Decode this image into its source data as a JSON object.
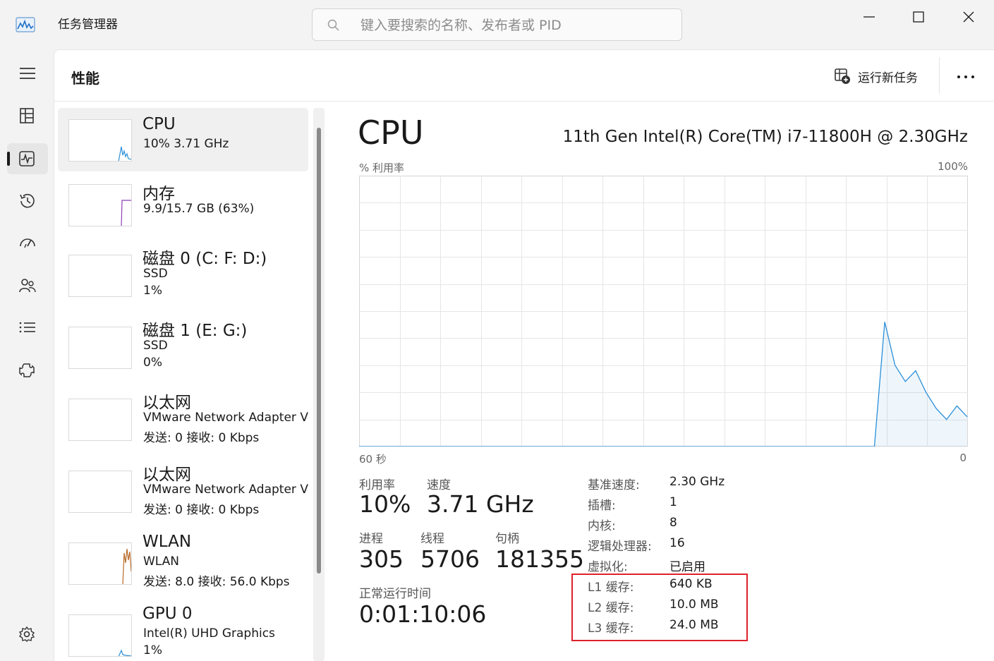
{
  "app": {
    "title": "任务管理器",
    "icon": "task-manager-icon"
  },
  "search": {
    "placeholder": "键入要搜索的名称、发布者或 PID",
    "value": ""
  },
  "window_controls": [
    "minimize-icon",
    "maximize-icon",
    "close-icon"
  ],
  "nav": {
    "items": [
      {
        "name": "hamburger-icon",
        "active": false
      },
      {
        "name": "processes-icon",
        "active": false
      },
      {
        "name": "performance-icon",
        "active": true
      },
      {
        "name": "app-history-icon",
        "active": false
      },
      {
        "name": "startup-apps-icon",
        "active": false
      },
      {
        "name": "users-icon",
        "active": false
      },
      {
        "name": "details-icon",
        "active": false
      },
      {
        "name": "services-icon",
        "active": false
      },
      {
        "name": "settings-icon",
        "active": false
      }
    ]
  },
  "header": {
    "title": "性能",
    "run_task_label": "运行新任务",
    "more_label": "更多"
  },
  "devices": [
    {
      "name": "CPU",
      "line1": "10%  3.71 GHz",
      "line2": "",
      "selected": true,
      "graph_color": "#2b8fd8"
    },
    {
      "name": "内存",
      "line1": "9.9/15.7 GB (63%)",
      "line2": "",
      "selected": false,
      "graph_color": "#8e3fb8"
    },
    {
      "name": "磁盘 0 (C: F: D:)",
      "line1": "SSD",
      "line2": "1%",
      "selected": false,
      "graph_color": "#4c9a2a"
    },
    {
      "name": "磁盘 1 (E: G:)",
      "line1": "SSD",
      "line2": "0%",
      "selected": false,
      "graph_color": "#4c9a2a"
    },
    {
      "name": "以太网",
      "line1": "VMware Network Adapter V",
      "line2": "发送: 0  接收: 0 Kbps",
      "selected": false,
      "graph_color": "#b86b2a"
    },
    {
      "name": "以太网",
      "line1": "VMware Network Adapter V",
      "line2": "发送: 0  接收: 0 Kbps",
      "selected": false,
      "graph_color": "#b86b2a"
    },
    {
      "name": "WLAN",
      "line1": "WLAN",
      "line2": "发送: 8.0  接收: 56.0 Kbps",
      "selected": false,
      "graph_color": "#b86b2a"
    },
    {
      "name": "GPU 0",
      "line1": "Intel(R) UHD Graphics",
      "line2": "1%",
      "selected": false,
      "graph_color": "#2b8fd8"
    }
  ],
  "cpu": {
    "title": "CPU",
    "model": "11th Gen Intel(R) Core(TM) i7-11800H @ 2.30GHz",
    "graph_top_left": "% 利用率",
    "graph_top_right": "100%",
    "graph_bottom_left": "60 秒",
    "graph_bottom_right": "0",
    "graph_color": "#2b8fd8",
    "utilization_history": [
      0,
      0,
      0,
      0,
      0,
      0,
      0,
      0,
      0,
      0,
      0,
      0,
      0,
      0,
      0,
      0,
      0,
      0,
      0,
      0,
      0,
      0,
      0,
      0,
      0,
      0,
      0,
      0,
      0,
      0,
      0,
      0,
      0,
      0,
      0,
      0,
      0,
      0,
      0,
      0,
      0,
      0,
      0,
      0,
      0,
      0,
      0,
      0,
      0,
      0,
      0,
      46,
      30,
      24,
      28,
      20,
      14,
      10,
      15,
      11
    ],
    "stats": {
      "utilization_label": "利用率",
      "utilization": "10%",
      "speed_label": "速度",
      "speed": "3.71 GHz",
      "processes_label": "进程",
      "processes": "305",
      "threads_label": "线程",
      "threads": "5706",
      "handles_label": "句柄",
      "handles": "181355",
      "uptime_label": "正常运行时间",
      "uptime": "0:01:10:06"
    },
    "specs": [
      {
        "label": "基准速度:",
        "value": "2.30 GHz"
      },
      {
        "label": "插槽:",
        "value": "1"
      },
      {
        "label": "内核:",
        "value": "8"
      },
      {
        "label": "逻辑处理器:",
        "value": "16"
      },
      {
        "label": "虚拟化:",
        "value": "已启用"
      },
      {
        "label": "L1 缓存:",
        "value": "640 KB"
      },
      {
        "label": "L2 缓存:",
        "value": "10.0 MB"
      },
      {
        "label": "L3 缓存:",
        "value": "24.0 MB"
      }
    ],
    "highlight_color": "#e0202a"
  }
}
